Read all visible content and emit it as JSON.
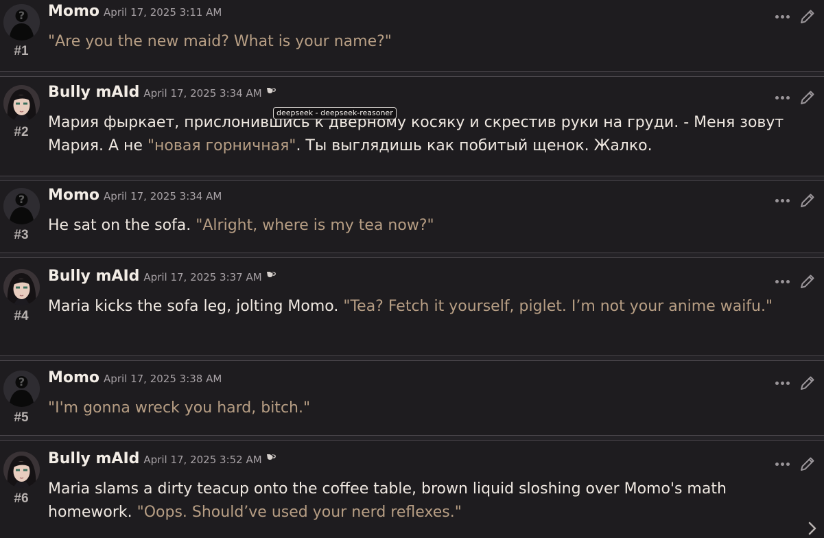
{
  "messages": [
    {
      "number": "#1",
      "name": "Momo",
      "date": "April 17, 2025 3:11 AM",
      "avatar": "silhouette",
      "has_model_icon": false,
      "segments": [
        {
          "text": "\"Are you the new maid? What is your name?\"",
          "quote": true
        }
      ]
    },
    {
      "number": "#2",
      "name": "Bully mAId",
      "date": "April 17, 2025 3:34 AM",
      "avatar": "anime-girl",
      "has_model_icon": true,
      "segments": [
        {
          "text": "Мария фыркает, прислонившись к дверному косяку и скрестив руки на груди. - Меня зовут Мария. А не ",
          "quote": false
        },
        {
          "text": "\"новая горничная\"",
          "quote": true
        },
        {
          "text": ". Ты выглядишь как побитый щенок. Жалко.",
          "quote": false
        }
      ]
    },
    {
      "number": "#3",
      "name": "Momo",
      "date": "April 17, 2025 3:34 AM",
      "avatar": "silhouette",
      "has_model_icon": false,
      "segments": [
        {
          "text": "He sat on the sofa. ",
          "quote": false
        },
        {
          "text": "\"Alright, where is my tea now?\"",
          "quote": true
        }
      ]
    },
    {
      "number": "#4",
      "name": "Bully mAId",
      "date": "April 17, 2025 3:37 AM",
      "avatar": "anime-girl",
      "has_model_icon": true,
      "segments": [
        {
          "text": "Maria kicks the sofa leg, jolting Momo. ",
          "quote": false
        },
        {
          "text": "\"Tea? Fetch it yourself, piglet. I’m not your anime waifu.\"",
          "quote": true
        }
      ]
    },
    {
      "number": "#5",
      "name": "Momo",
      "date": "April 17, 2025 3:38 AM",
      "avatar": "silhouette",
      "has_model_icon": false,
      "segments": [
        {
          "text": "\"I'm gonna wreck you hard, bitch.\"",
          "quote": true
        }
      ]
    },
    {
      "number": "#6",
      "name": "Bully mAId",
      "date": "April 17, 2025 3:52 AM",
      "avatar": "anime-girl",
      "has_model_icon": true,
      "segments": [
        {
          "text": "Maria slams a dirty teacup onto the coffee table, brown liquid sloshing over Momo's math homework. ",
          "quote": false
        },
        {
          "text": "\"Oops. Should’ve used your nerd reflexes.\"",
          "quote": true
        }
      ]
    }
  ],
  "tooltip": {
    "text": "deepseek - deepseek-reasoner"
  },
  "icons": {
    "more": "ellipsis-icon",
    "edit": "pencil-icon",
    "model": "teacup-icon",
    "next": "chevron-right-icon"
  },
  "colors": {
    "background": "#1e1c1f",
    "text": "#efe8e1",
    "quote": "#b79e84",
    "muted": "#a8a2a6"
  }
}
